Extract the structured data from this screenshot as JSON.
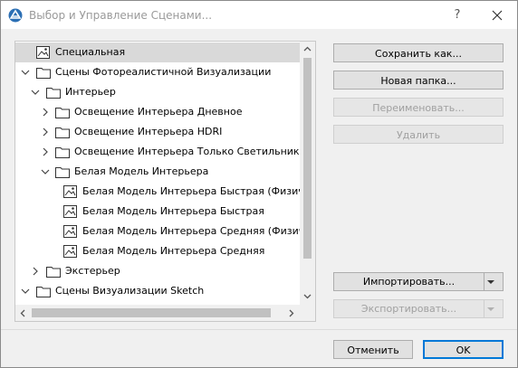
{
  "window": {
    "title": "Выбор и Управление Сценами...",
    "help": "?"
  },
  "tree": {
    "items": [
      {
        "label": "Специальная",
        "icon": "scene-icon",
        "selected": true
      },
      {
        "label": "Сцены Фотореалистичной Визуализации",
        "icon": "folder-icon",
        "expanded": true
      },
      {
        "label": "Интерьер",
        "icon": "folder-icon",
        "expanded": true
      },
      {
        "label": "Освещение Интерьера Дневное",
        "icon": "folder-icon",
        "expanded": false
      },
      {
        "label": "Освещение Интерьера HDRI",
        "icon": "folder-icon",
        "expanded": false
      },
      {
        "label": "Освещение Интерьера Только Светильниками",
        "icon": "folder-icon",
        "expanded": false
      },
      {
        "label": "Белая Модель Интерьера",
        "icon": "folder-icon",
        "expanded": true
      },
      {
        "label": "Белая Модель Интерьера Быстрая (Физическая",
        "icon": "scene-icon"
      },
      {
        "label": "Белая Модель Интерьера Быстрая",
        "icon": "scene-icon"
      },
      {
        "label": "Белая Модель Интерьера Средняя (Физическая",
        "icon": "scene-icon"
      },
      {
        "label": "Белая Модель Интерьера Средняя",
        "icon": "scene-icon"
      },
      {
        "label": "Экстерьер",
        "icon": "folder-icon",
        "expanded": false
      },
      {
        "label": "Сцены Визуализации Sketch",
        "icon": "folder-icon",
        "expanded": true
      }
    ]
  },
  "buttons": {
    "save_as": "Сохранить как...",
    "new_folder": "Новая папка...",
    "rename": "Переименовать...",
    "delete": "Удалить",
    "import": "Импортировать...",
    "export": "Экспортировать...",
    "cancel": "Отменить",
    "ok": "OK"
  },
  "colors": {
    "accent": "#0078d7",
    "selection": "#d9d9d9",
    "disabled_text": "#a0a0a0"
  }
}
